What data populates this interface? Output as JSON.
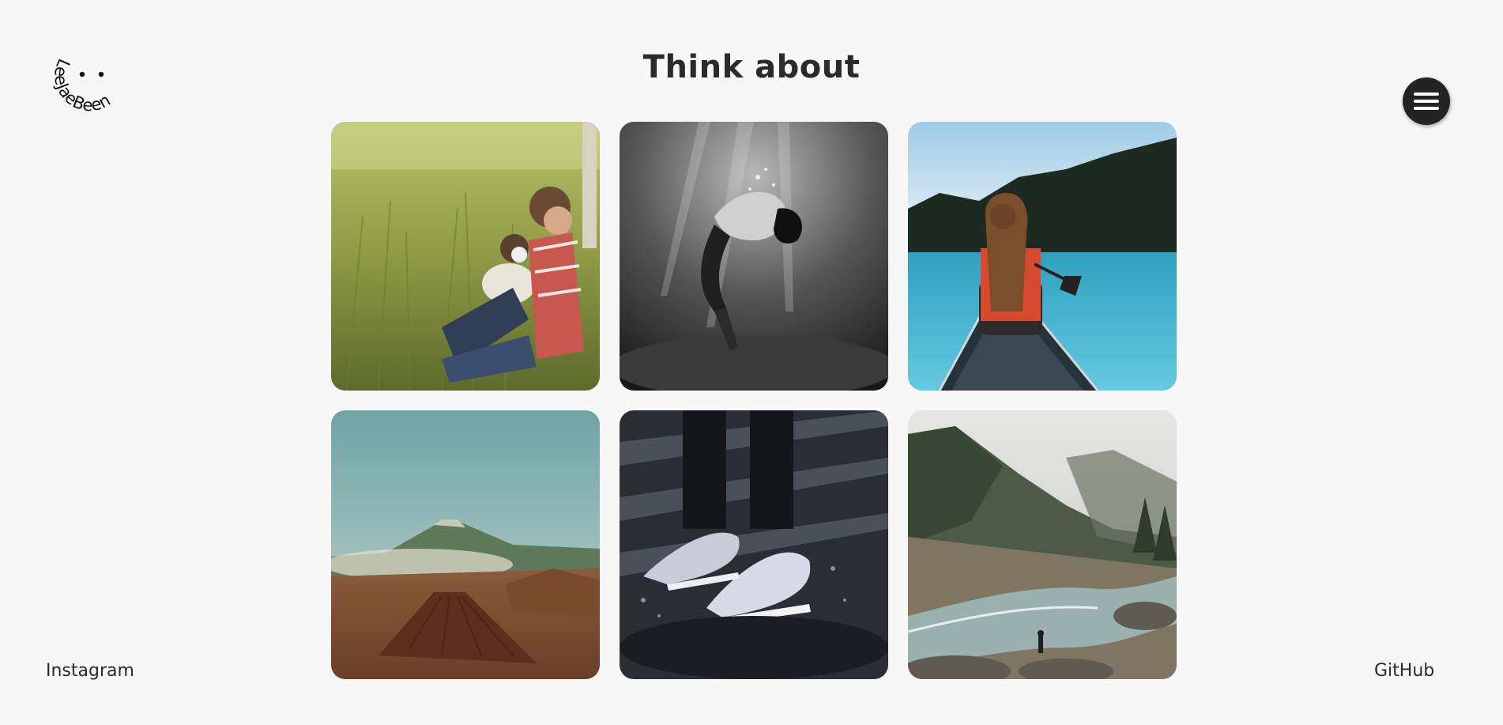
{
  "logo": {
    "text": "LeeJaeBeen"
  },
  "header": {
    "title": "Think about"
  },
  "menu": {
    "icon": "hamburger-icon"
  },
  "gallery": {
    "photos": [
      {
        "subject": "man-and-dog-in-grass-photo"
      },
      {
        "subject": "underwater-person-photo"
      },
      {
        "subject": "woman-in-canoe-photo"
      },
      {
        "subject": "volcano-landscape-photo"
      },
      {
        "subject": "sneakers-splash-photo"
      },
      {
        "subject": "river-valley-photo"
      }
    ]
  },
  "footer": {
    "left_link": "Instagram",
    "right_link": "GitHub"
  },
  "colors": {
    "background": "#f7f7f7",
    "text": "#2a2a2a",
    "menu_button": "#232323"
  }
}
